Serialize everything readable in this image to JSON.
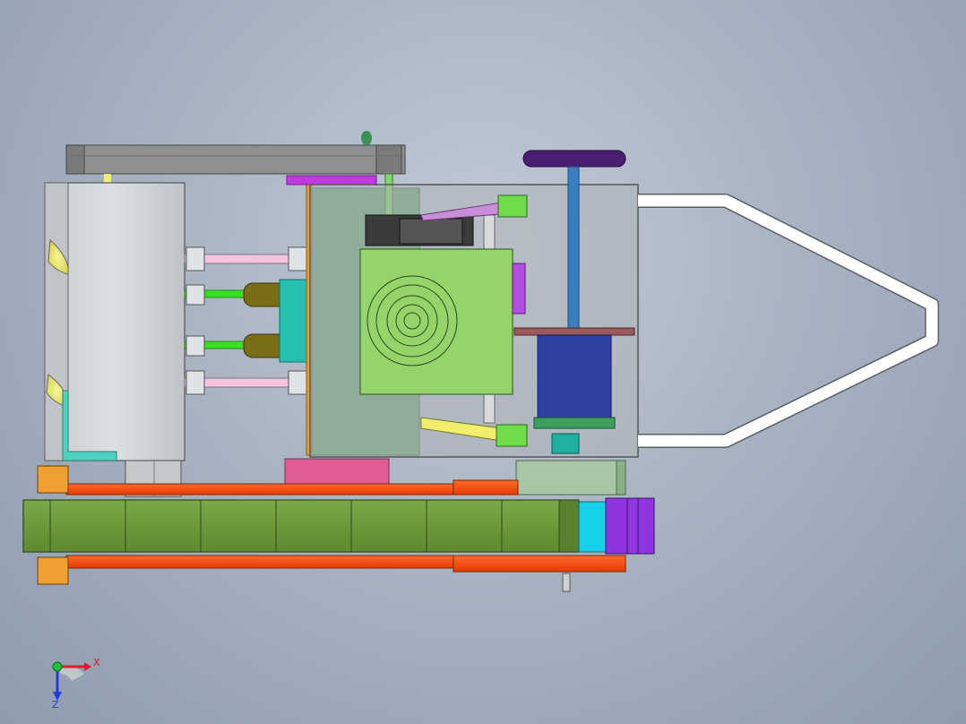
{
  "triad": {
    "x_label": "X",
    "z_label": "Z"
  },
  "colors": {
    "background_center": "#c2cad6",
    "background_edge": "#8f9cae",
    "conveyor_green": "#6f9a3b",
    "frame_orange": "#ff4a12",
    "motor_purple": "#8f35e0",
    "tube_white": "#ffffff",
    "machine_green": "#94d46a",
    "housing_gray": "#d3d6d9"
  },
  "icons": {
    "triad": "coordinate-triad-icon"
  }
}
